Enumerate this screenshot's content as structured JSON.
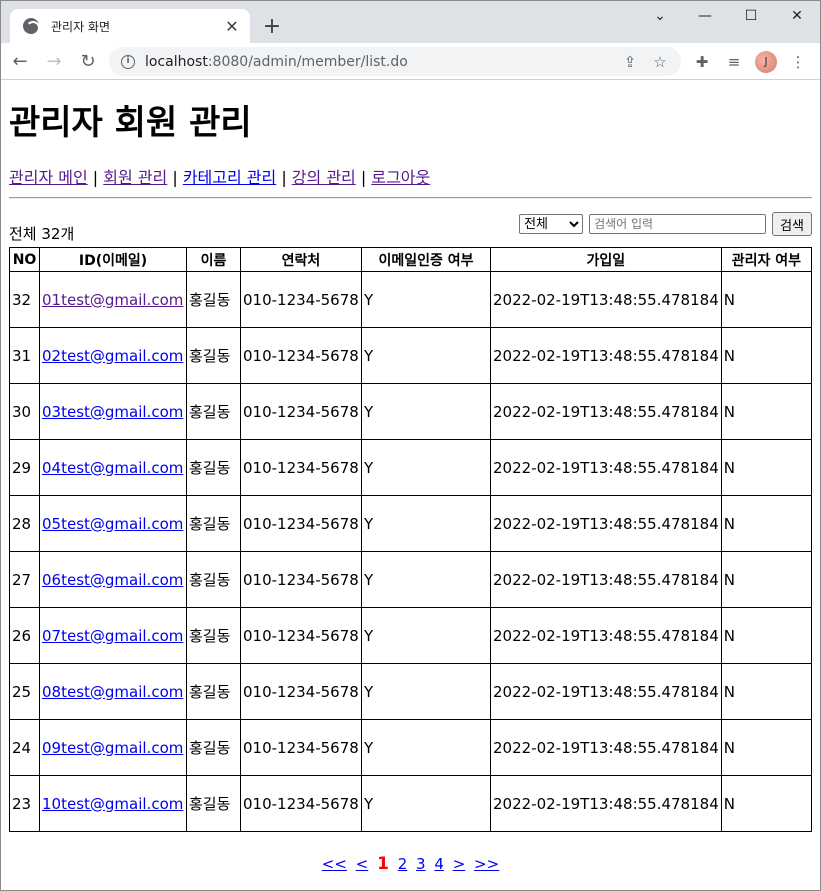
{
  "browser": {
    "tab_title": "관리자 화면",
    "url_host": "localhost",
    "url_rest": ":8080/admin/member/list.do",
    "avatar_initial": "J"
  },
  "page": {
    "title": "관리자 회원 관리",
    "menu": [
      {
        "label": "관리자 메인"
      },
      {
        "label": "회원 관리"
      },
      {
        "label": "카테고리 관리"
      },
      {
        "label": "강의 관리"
      },
      {
        "label": "로그아웃"
      }
    ],
    "menu_separator": "|",
    "total_label": "전체 32개",
    "search": {
      "select_value": "전체",
      "input_placeholder": "검색어 입력",
      "button_label": "검색"
    }
  },
  "table": {
    "headers": [
      "NO",
      "ID(이메일)",
      "이름",
      "연락처",
      "이메일인증 여부",
      "가입일",
      "관리자 여부"
    ],
    "rows": [
      {
        "no": "32",
        "email": "01test@gmail.com",
        "name": "홍길동",
        "phone": "010-1234-5678",
        "email_auth": "Y",
        "reg_date": "2022-02-19T13:48:55.478184",
        "admin": "N"
      },
      {
        "no": "31",
        "email": "02test@gmail.com",
        "name": "홍길동",
        "phone": "010-1234-5678",
        "email_auth": "Y",
        "reg_date": "2022-02-19T13:48:55.478184",
        "admin": "N"
      },
      {
        "no": "30",
        "email": "03test@gmail.com",
        "name": "홍길동",
        "phone": "010-1234-5678",
        "email_auth": "Y",
        "reg_date": "2022-02-19T13:48:55.478184",
        "admin": "N"
      },
      {
        "no": "29",
        "email": "04test@gmail.com",
        "name": "홍길동",
        "phone": "010-1234-5678",
        "email_auth": "Y",
        "reg_date": "2022-02-19T13:48:55.478184",
        "admin": "N"
      },
      {
        "no": "28",
        "email": "05test@gmail.com",
        "name": "홍길동",
        "phone": "010-1234-5678",
        "email_auth": "Y",
        "reg_date": "2022-02-19T13:48:55.478184",
        "admin": "N"
      },
      {
        "no": "27",
        "email": "06test@gmail.com",
        "name": "홍길동",
        "phone": "010-1234-5678",
        "email_auth": "Y",
        "reg_date": "2022-02-19T13:48:55.478184",
        "admin": "N"
      },
      {
        "no": "26",
        "email": "07test@gmail.com",
        "name": "홍길동",
        "phone": "010-1234-5678",
        "email_auth": "Y",
        "reg_date": "2022-02-19T13:48:55.478184",
        "admin": "N"
      },
      {
        "no": "25",
        "email": "08test@gmail.com",
        "name": "홍길동",
        "phone": "010-1234-5678",
        "email_auth": "Y",
        "reg_date": "2022-02-19T13:48:55.478184",
        "admin": "N"
      },
      {
        "no": "24",
        "email": "09test@gmail.com",
        "name": "홍길동",
        "phone": "010-1234-5678",
        "email_auth": "Y",
        "reg_date": "2022-02-19T13:48:55.478184",
        "admin": "N"
      },
      {
        "no": "23",
        "email": "10test@gmail.com",
        "name": "홍길동",
        "phone": "010-1234-5678",
        "email_auth": "Y",
        "reg_date": "2022-02-19T13:48:55.478184",
        "admin": "N"
      }
    ]
  },
  "pager": {
    "first": "<<",
    "prev": "<",
    "pages": [
      "1",
      "2",
      "3",
      "4"
    ],
    "current": "1",
    "next": ">",
    "last": ">>"
  }
}
